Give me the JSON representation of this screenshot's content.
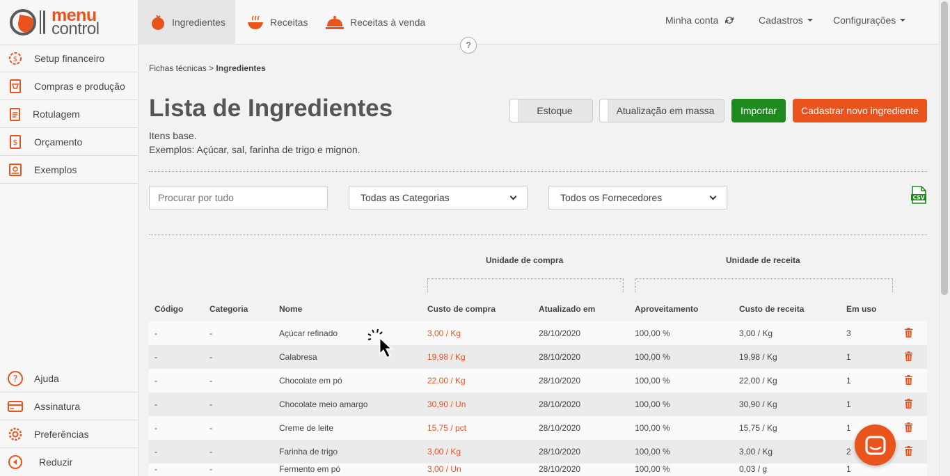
{
  "brand": {
    "line1": "menu",
    "line2": "control"
  },
  "sidebar": {
    "items": [
      {
        "label": "Setup financeiro",
        "icon": "gear-dollar-icon"
      },
      {
        "label": "Compras e produção",
        "icon": "shopping-list-icon"
      },
      {
        "label": "Rotulagem",
        "icon": "label-icon"
      },
      {
        "label": "Orçamento",
        "icon": "budget-icon"
      },
      {
        "label": "Exemplos",
        "icon": "examples-book-icon"
      }
    ],
    "bottom": [
      {
        "label": "Ajuda",
        "icon": "help-icon"
      },
      {
        "label": "Assinatura",
        "icon": "credit-card-icon"
      },
      {
        "label": "Preferências",
        "icon": "settings-icon"
      },
      {
        "label": "Reduzir",
        "icon": "collapse-icon"
      }
    ]
  },
  "topnav": {
    "tabs": [
      {
        "label": "Ingredientes",
        "icon": "tomato-icon"
      },
      {
        "label": "Receitas",
        "icon": "bowl-icon"
      },
      {
        "label": "Receitas à venda",
        "icon": "cloche-icon"
      }
    ],
    "account": "Minha conta",
    "cadastros": "Cadastros",
    "config": "Configurações",
    "help": "?"
  },
  "breadcrumb": {
    "parent": "Fichas técnicas",
    "sep": ">",
    "current": "Ingredientes"
  },
  "page": {
    "title": "Lista de Ingredientes",
    "desc1": "Itens base.",
    "desc2": "Exemplos: Açúcar, sal, farinha de trigo e mignon."
  },
  "actions": {
    "estoque": "Estoque",
    "massa": "Atualização em massa",
    "importar": "Importar",
    "novo": "Cadastrar novo ingrediente"
  },
  "filters": {
    "search_placeholder": "Procurar por tudo",
    "categorias": "Todas as Categorias",
    "fornecedores": "Todos os Fornecedores",
    "csv": "CSV"
  },
  "colors": {
    "accent": "#e8541c",
    "green": "#1e8a1e"
  },
  "table": {
    "groups": {
      "compra": "Unidade de compra",
      "receita": "Unidade de receita"
    },
    "headers": [
      "Código",
      "Categoria",
      "Nome",
      "Custo de compra",
      "Atualizado em",
      "Aproveitamento",
      "Custo de receita",
      "Em uso"
    ],
    "rows": [
      {
        "codigo": "-",
        "categoria": "-",
        "nome": "Açúcar refinado",
        "custo": "3,00 / Kg",
        "data": "28/10/2020",
        "aprov": "100,00 %",
        "receita": "3,00 / Kg",
        "uso": "3"
      },
      {
        "codigo": "-",
        "categoria": "-",
        "nome": "Calabresa",
        "custo": "19,98 / Kg",
        "data": "28/10/2020",
        "aprov": "100,00 %",
        "receita": "19,98 / Kg",
        "uso": "1"
      },
      {
        "codigo": "-",
        "categoria": "-",
        "nome": "Chocolate em pó",
        "custo": "22,00 / Kg",
        "data": "28/10/2020",
        "aprov": "100,00 %",
        "receita": "22,00 / Kg",
        "uso": "1"
      },
      {
        "codigo": "-",
        "categoria": "-",
        "nome": "Chocolate meio amargo",
        "custo": "30,90 / Un",
        "data": "28/10/2020",
        "aprov": "100,00 %",
        "receita": "30,90 / Kg",
        "uso": "1"
      },
      {
        "codigo": "-",
        "categoria": "-",
        "nome": "Creme de leite",
        "custo": "15,75 / pct",
        "data": "28/10/2020",
        "aprov": "100,00 %",
        "receita": "15,75 / Kg",
        "uso": "1"
      },
      {
        "codigo": "-",
        "categoria": "-",
        "nome": "Farinha de trigo",
        "custo": "3,00 / Kg",
        "data": "28/10/2020",
        "aprov": "100,00 %",
        "receita": "3,00 / Kg",
        "uso": "2"
      },
      {
        "codigo": "-",
        "categoria": "-",
        "nome": "Fermento em pó",
        "custo": "3,00 / Un",
        "data": "28/10/2020",
        "aprov": "100,00 %",
        "receita": "0,03 / g",
        "uso": "1"
      }
    ]
  }
}
